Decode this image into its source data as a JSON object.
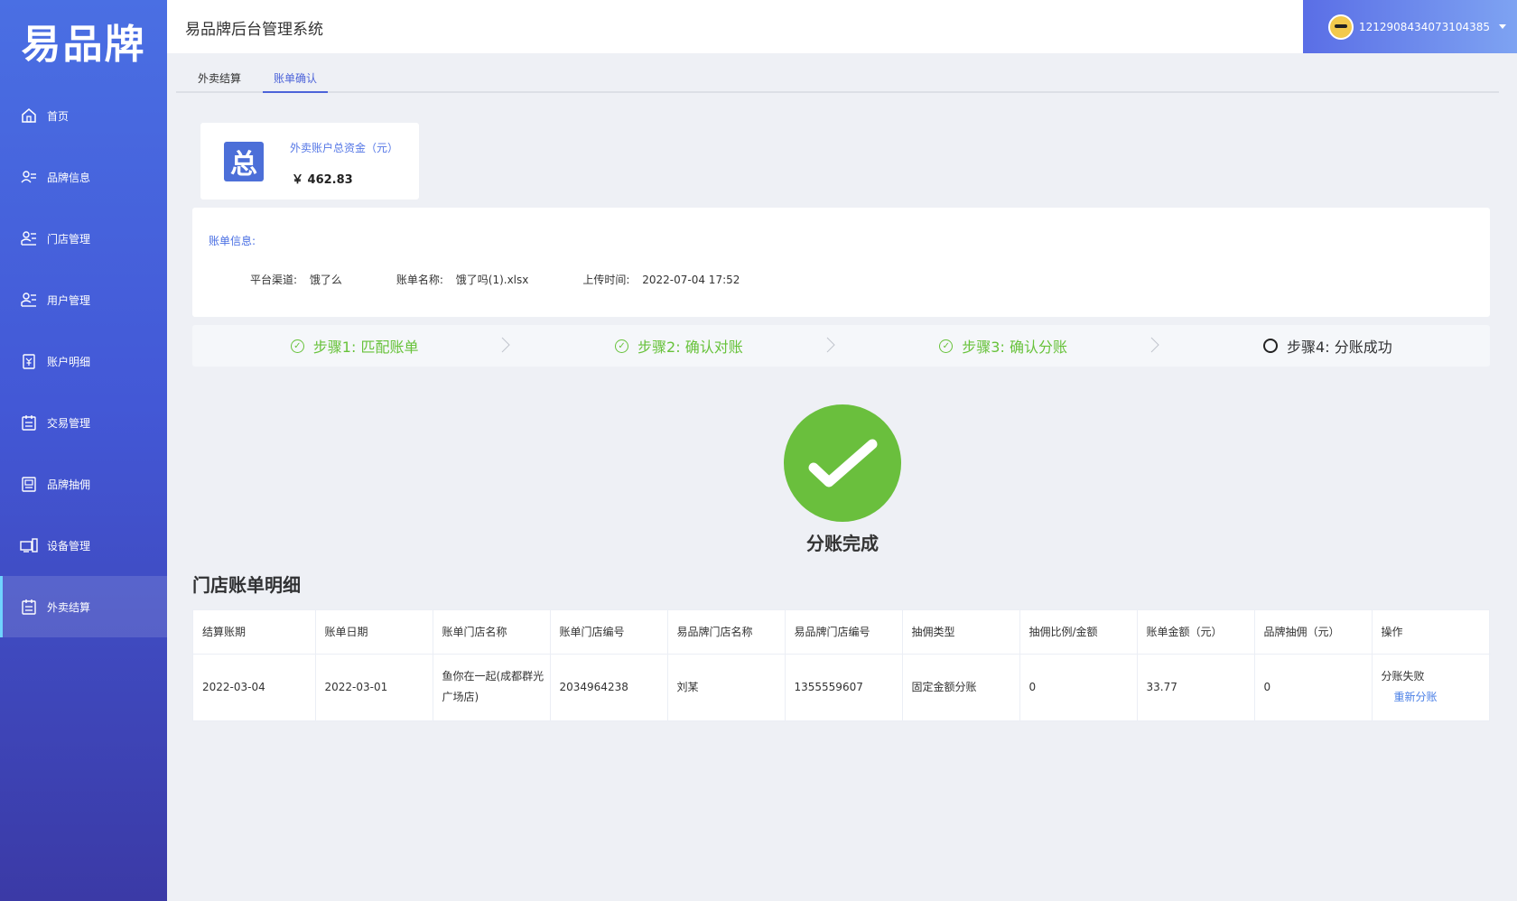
{
  "app": {
    "logo_text": "易品牌",
    "system_title": "易品牌后台管理系统",
    "username": "1212908434073104385"
  },
  "sidebar": {
    "items": [
      {
        "label": "首页",
        "icon": "home-icon"
      },
      {
        "label": "品牌信息",
        "icon": "brand-info-icon"
      },
      {
        "label": "门店管理",
        "icon": "store-icon"
      },
      {
        "label": "用户管理",
        "icon": "user-icon"
      },
      {
        "label": "账户明细",
        "icon": "account-icon"
      },
      {
        "label": "交易管理",
        "icon": "transaction-icon"
      },
      {
        "label": "品牌抽佣",
        "icon": "commission-icon"
      },
      {
        "label": "设备管理",
        "icon": "device-icon"
      },
      {
        "label": "外卖结算",
        "icon": "delivery-settle-icon",
        "active": true
      }
    ]
  },
  "tabs": [
    {
      "label": "外卖结算",
      "active": false
    },
    {
      "label": "账单确认",
      "active": true
    }
  ],
  "total_card": {
    "icon_char": "总",
    "label": "外卖账户总资金（元）",
    "value": "￥ 462.83"
  },
  "bill_info": {
    "title": "账单信息:",
    "channel_label": "平台渠道:",
    "channel_value": "饿了么",
    "name_label": "账单名称:",
    "name_value": "饿了吗(1).xlsx",
    "time_label": "上传时间:",
    "time_value": "2022-07-04 17:52"
  },
  "steps": [
    {
      "label": "步骤1: 匹配账单",
      "status": "done"
    },
    {
      "label": "步骤2: 确认对账",
      "status": "done"
    },
    {
      "label": "步骤3: 确认分账",
      "status": "done"
    },
    {
      "label": "步骤4: 分账成功",
      "status": "current"
    }
  ],
  "success": {
    "text": "分账完成",
    "color": "#6abf3d"
  },
  "section_title": "门店账单明细",
  "table": {
    "headers": [
      "结算账期",
      "账单日期",
      "账单门店名称",
      "账单门店编号",
      "易品牌门店名称",
      "易品牌门店编号",
      "抽佣类型",
      "抽佣比例/金额",
      "账单金额（元）",
      "品牌抽佣（元）",
      "操作"
    ],
    "rows": [
      {
        "settle_period": "2022-03-04",
        "bill_date": "2022-03-01",
        "bill_store_name": "鱼你在一起(成都群光广场店)",
        "bill_store_no": "2034964238",
        "ypp_store_name": "刘某",
        "ypp_store_no": "1355559607",
        "commission_type": "固定金额分账",
        "commission_rate": "0",
        "bill_amount": "33.77",
        "brand_commission": "0",
        "op_status": "分账失败",
        "op_link": "重新分账"
      }
    ]
  }
}
